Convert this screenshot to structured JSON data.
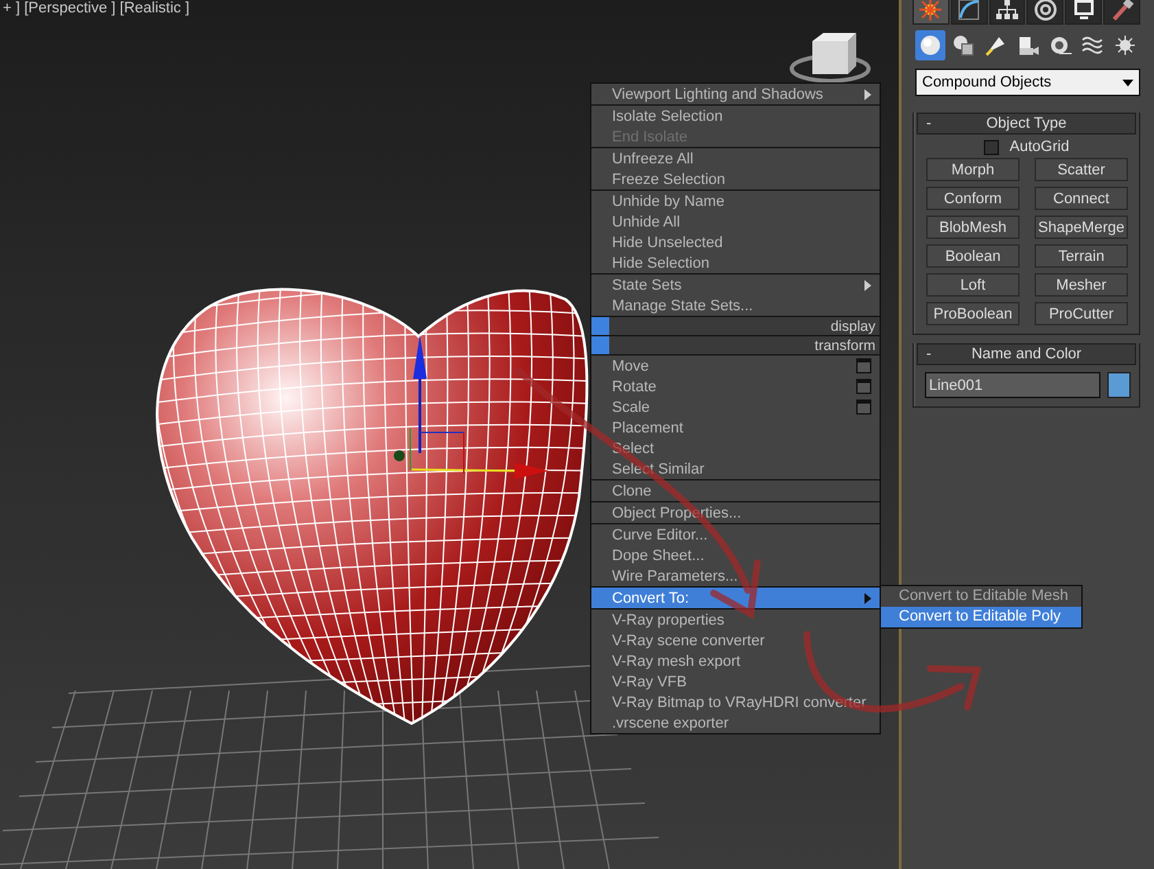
{
  "viewport": {
    "label": "+ ] [Perspective ] [Realistic ]"
  },
  "context_menu": {
    "groups": [
      [
        {
          "kind": "item",
          "label": "Viewport Lighting and Shadows",
          "disabled": false,
          "submenu": true,
          "options": false,
          "selected": false
        }
      ],
      [
        {
          "kind": "item",
          "label": "Isolate Selection",
          "disabled": false,
          "submenu": false,
          "options": false,
          "selected": false
        },
        {
          "kind": "item",
          "label": "End Isolate",
          "disabled": true,
          "submenu": false,
          "options": false,
          "selected": false
        }
      ],
      [
        {
          "kind": "item",
          "label": "Unfreeze All",
          "disabled": false,
          "submenu": false,
          "options": false,
          "selected": false
        },
        {
          "kind": "item",
          "label": "Freeze Selection",
          "disabled": false,
          "submenu": false,
          "options": false,
          "selected": false
        }
      ],
      [
        {
          "kind": "item",
          "label": "Unhide by Name",
          "disabled": false,
          "submenu": false,
          "options": false,
          "selected": false
        },
        {
          "kind": "item",
          "label": "Unhide All",
          "disabled": false,
          "submenu": false,
          "options": false,
          "selected": false
        },
        {
          "kind": "item",
          "label": "Hide Unselected",
          "disabled": false,
          "submenu": false,
          "options": false,
          "selected": false
        },
        {
          "kind": "item",
          "label": "Hide Selection",
          "disabled": false,
          "submenu": false,
          "options": false,
          "selected": false
        }
      ],
      [
        {
          "kind": "item",
          "label": "State Sets",
          "disabled": false,
          "submenu": true,
          "options": false,
          "selected": false
        },
        {
          "kind": "item",
          "label": "Manage State Sets...",
          "disabled": false,
          "submenu": false,
          "options": false,
          "selected": false
        }
      ],
      [
        {
          "kind": "section",
          "label": "display"
        }
      ],
      [
        {
          "kind": "section",
          "label": "transform"
        }
      ],
      [
        {
          "kind": "item",
          "label": "Move",
          "disabled": false,
          "submenu": false,
          "options": true,
          "selected": false
        },
        {
          "kind": "item",
          "label": "Rotate",
          "disabled": false,
          "submenu": false,
          "options": true,
          "selected": false
        },
        {
          "kind": "item",
          "label": "Scale",
          "disabled": false,
          "submenu": false,
          "options": true,
          "selected": false
        },
        {
          "kind": "item",
          "label": "Placement",
          "disabled": false,
          "submenu": false,
          "options": false,
          "selected": false
        },
        {
          "kind": "item",
          "label": "Select",
          "disabled": false,
          "submenu": false,
          "options": false,
          "selected": false
        },
        {
          "kind": "item",
          "label": "Select Similar",
          "disabled": false,
          "submenu": false,
          "options": false,
          "selected": false
        }
      ],
      [
        {
          "kind": "item",
          "label": "Clone",
          "disabled": false,
          "submenu": false,
          "options": false,
          "selected": false
        }
      ],
      [
        {
          "kind": "item",
          "label": "Object Properties...",
          "disabled": false,
          "submenu": false,
          "options": false,
          "selected": false
        }
      ],
      [
        {
          "kind": "item",
          "label": "Curve Editor...",
          "disabled": false,
          "submenu": false,
          "options": false,
          "selected": false
        },
        {
          "kind": "item",
          "label": "Dope Sheet...",
          "disabled": false,
          "submenu": false,
          "options": false,
          "selected": false
        },
        {
          "kind": "item",
          "label": "Wire Parameters...",
          "disabled": false,
          "submenu": false,
          "options": false,
          "selected": false
        },
        {
          "kind": "item",
          "label": "Convert To:",
          "disabled": false,
          "submenu": true,
          "options": false,
          "selected": true
        },
        {
          "kind": "item",
          "label": "V-Ray properties",
          "disabled": false,
          "submenu": false,
          "options": false,
          "selected": false
        },
        {
          "kind": "item",
          "label": "V-Ray scene converter",
          "disabled": false,
          "submenu": false,
          "options": false,
          "selected": false
        },
        {
          "kind": "item",
          "label": "V-Ray mesh export",
          "disabled": false,
          "submenu": false,
          "options": false,
          "selected": false
        },
        {
          "kind": "item",
          "label": "V-Ray VFB",
          "disabled": false,
          "submenu": false,
          "options": false,
          "selected": false
        },
        {
          "kind": "item",
          "label": "V-Ray Bitmap to VRayHDRI converter",
          "disabled": false,
          "submenu": false,
          "options": false,
          "selected": false
        },
        {
          "kind": "item",
          "label": ".vrscene exporter",
          "disabled": false,
          "submenu": false,
          "options": false,
          "selected": false
        }
      ]
    ]
  },
  "submenu": {
    "items": [
      {
        "label": "Convert to Editable Mesh",
        "selected": false
      },
      {
        "label": "Convert to Editable Poly",
        "selected": true
      }
    ]
  },
  "command_panel": {
    "tabs": [
      {
        "selected": true
      },
      {
        "selected": false
      },
      {
        "selected": false
      },
      {
        "selected": false
      },
      {
        "selected": false
      },
      {
        "selected": false
      }
    ],
    "categories": [
      {
        "selected": true
      },
      {
        "selected": false
      },
      {
        "selected": false
      },
      {
        "selected": false
      },
      {
        "selected": false
      },
      {
        "selected": false
      },
      {
        "selected": false
      }
    ],
    "dropdown": {
      "value": "Compound Objects"
    },
    "object_type": {
      "collapse": "-",
      "title": "Object Type",
      "autogrid": {
        "label": "AutoGrid",
        "checked": false
      },
      "buttons": [
        "Morph",
        "Scatter",
        "Conform",
        "Connect",
        "BlobMesh",
        "ShapeMerge",
        "Boolean",
        "Terrain",
        "Loft",
        "Mesher",
        "ProBoolean",
        "ProCutter"
      ]
    },
    "name_and_color": {
      "collapse": "-",
      "title": "Name and Color",
      "name": "Line001",
      "color": "#5b9bd5"
    }
  }
}
